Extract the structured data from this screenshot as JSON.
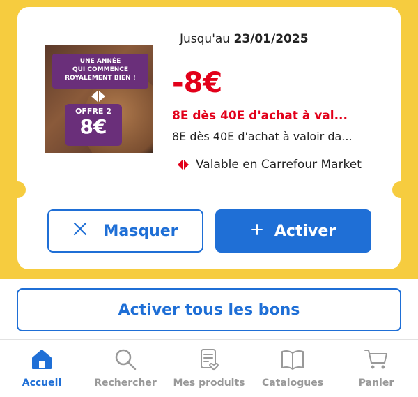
{
  "coupon": {
    "valid_prefix": "Jusqu'au",
    "valid_date": "23/01/2025",
    "discount": "-8€",
    "title": "8E dès 40E d'achat à val...",
    "description": "8E dès 40E d'achat à valoir da...",
    "store": "Valable en Carrefour Market",
    "image": {
      "banner_line1": "UNE ANNÉE",
      "banner_line2": "QUI COMMENCE",
      "banner_line3": "ROYALEMENT BIEN !",
      "offer_label": "OFFRE 2",
      "offer_amount": "8€"
    }
  },
  "buttons": {
    "hide": "Masquer",
    "activate": "Activer",
    "activate_all": "Activer tous les bons"
  },
  "nav": [
    {
      "label": "Accueil",
      "icon": "home-icon",
      "active": true
    },
    {
      "label": "Rechercher",
      "icon": "search-icon",
      "active": false
    },
    {
      "label": "Mes produits",
      "icon": "list-heart-icon",
      "active": false
    },
    {
      "label": "Catalogues",
      "icon": "book-icon",
      "active": false
    },
    {
      "label": "Panier",
      "icon": "cart-icon",
      "active": false
    }
  ],
  "colors": {
    "accent": "#1f6fd6",
    "promo_red": "#e2001a",
    "background_yellow": "#f6cc3f"
  }
}
